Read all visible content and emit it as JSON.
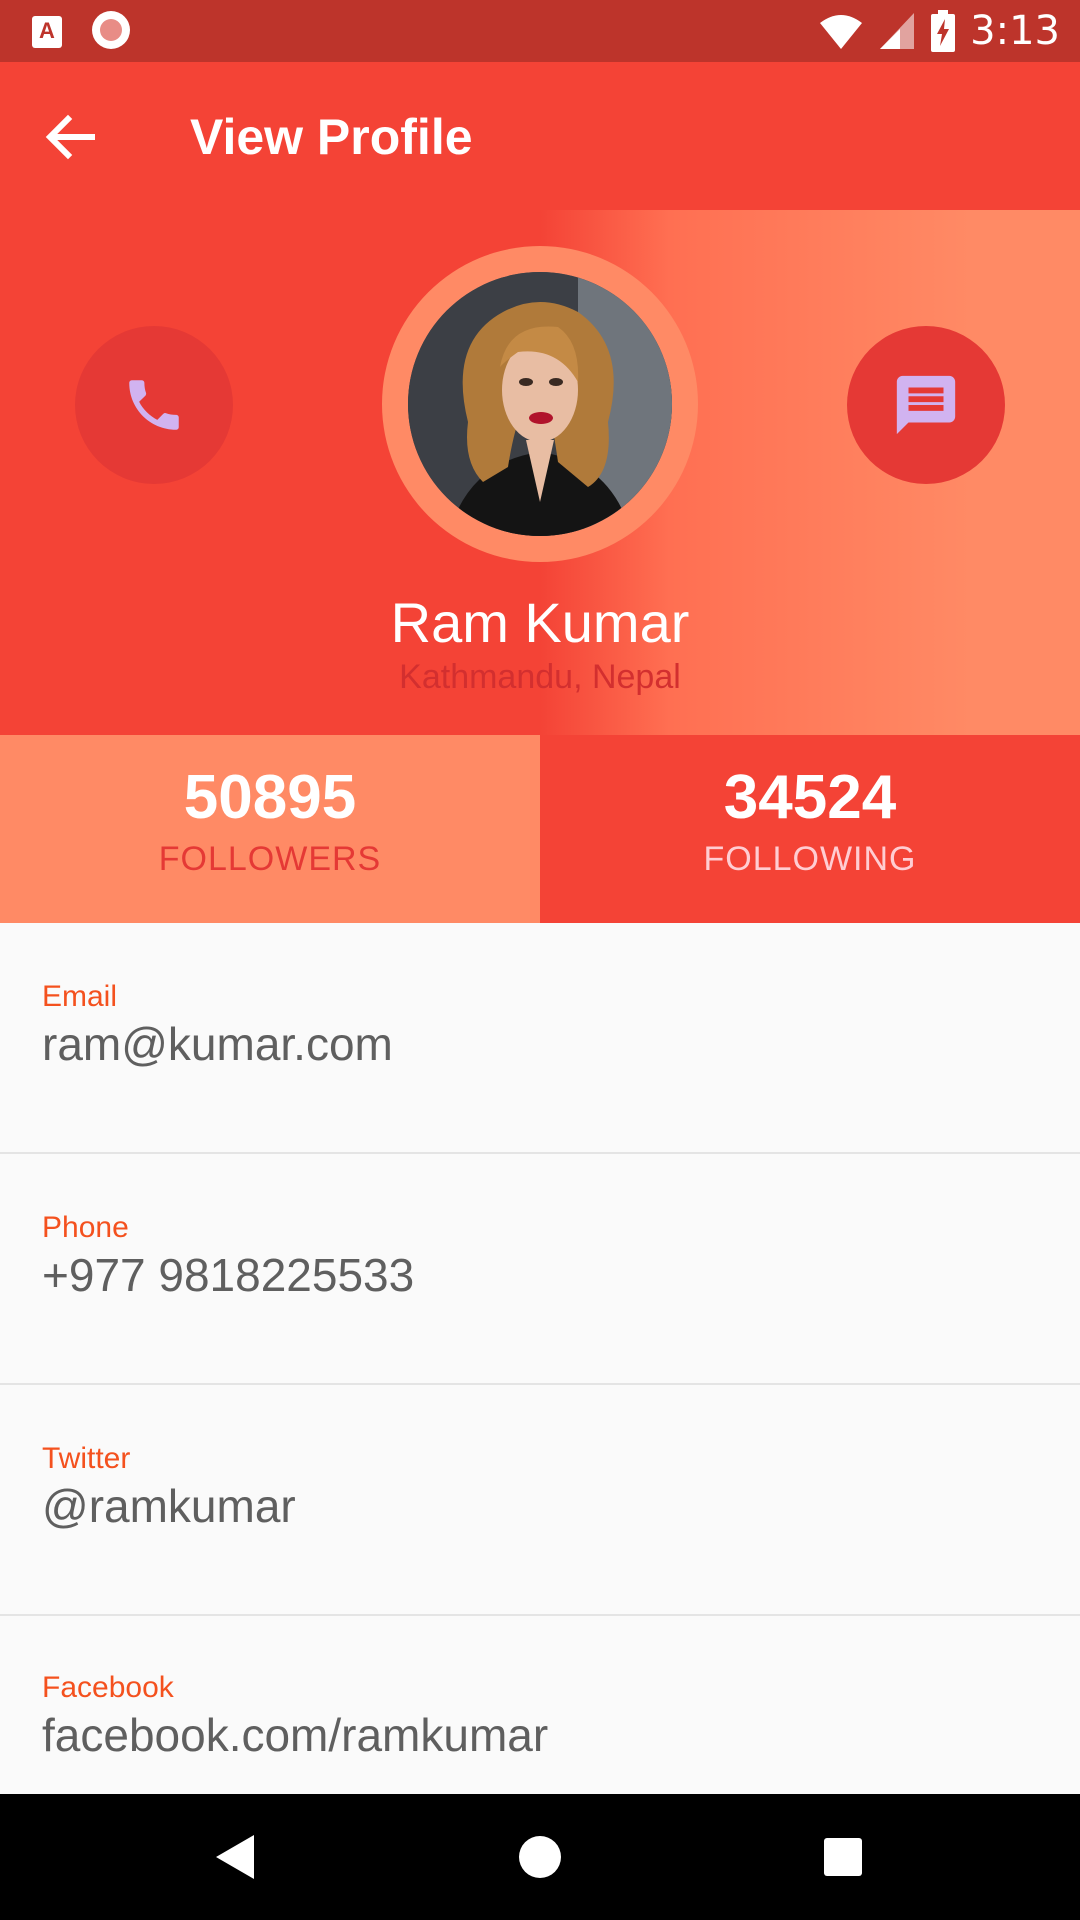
{
  "status_bar": {
    "time": "3:13",
    "left_icons": [
      "app-a-icon",
      "record-icon"
    ],
    "right_icons": [
      "wifi-icon",
      "signal-icon",
      "battery-charging-icon"
    ]
  },
  "app_bar": {
    "title": "View Profile",
    "back_icon": "arrow-back-icon"
  },
  "profile": {
    "name": "Ram Kumar",
    "location": "Kathmandu, Nepal",
    "call_icon": "phone-icon",
    "message_icon": "message-icon"
  },
  "stats": {
    "followers": {
      "value": "50895",
      "label": "FOLLOWERS"
    },
    "following": {
      "value": "34524",
      "label": "FOLLOWING"
    }
  },
  "info": [
    {
      "label": "Email",
      "value": "ram@kumar.com"
    },
    {
      "label": "Phone",
      "value": "+977 9818225533"
    },
    {
      "label": "Twitter",
      "value": "@ramkumar"
    },
    {
      "label": "Facebook",
      "value": "facebook.com/ramkumar"
    }
  ],
  "nav_bar": {
    "icons": [
      "nav-back-icon",
      "nav-home-icon",
      "nav-recents-icon"
    ]
  },
  "colors": {
    "status_bar": "#bd342b",
    "primary": "#f44336",
    "accent": "#ff8a65",
    "label_accent": "#f4511e",
    "icon_tint": "#d1b3f0"
  }
}
